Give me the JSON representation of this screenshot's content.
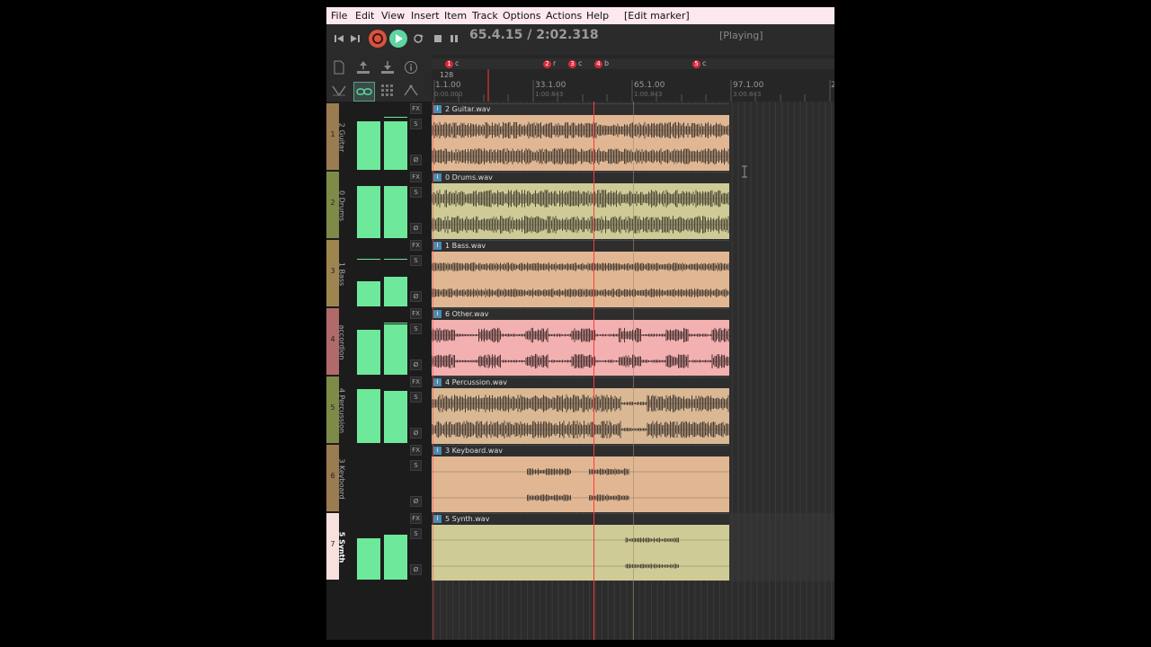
{
  "menu": {
    "file": "File",
    "edit": "Edit",
    "view": "View",
    "insert": "Insert",
    "item": "Item",
    "track": "Track",
    "options": "Options",
    "actions": "Actions",
    "help": "Help",
    "context": "[Edit marker]"
  },
  "transport": {
    "time": "65.4.15 / 2:02.318",
    "status": "[Playing]"
  },
  "ruler": {
    "tempo": "128",
    "markers": [
      {
        "num": "1",
        "label": "c"
      },
      {
        "num": "2",
        "label": "r"
      },
      {
        "num": "3",
        "label": "c"
      },
      {
        "num": "4",
        "label": "b"
      },
      {
        "num": "5",
        "label": "c"
      }
    ],
    "ticks": [
      {
        "bar": "1.1.00",
        "time": "0:00.000"
      },
      {
        "bar": "33.1.00",
        "time": "1:00.843"
      },
      {
        "bar": "65.1.00",
        "time": "1:00.843"
      },
      {
        "bar": "97.1.00",
        "time": "3:00.843"
      },
      {
        "bar": "2",
        "time": ""
      }
    ]
  },
  "tracks": [
    {
      "number": "1",
      "name": "2 Guitar",
      "item": "2 Guitar.wav",
      "color": "#9b7b50",
      "item_color": "#e1b793",
      "wave_color": "#4a4037",
      "meter": [
        0.93,
        0.93
      ],
      "peak": [
        0.95,
        0.95
      ]
    },
    {
      "number": "2",
      "name": "0 Drums",
      "item": "0 Drums.wav",
      "color": "#7e8b48",
      "item_color": "#cfcb96",
      "wave_color": "#4c4a3a",
      "meter": [
        0.98,
        0.98
      ],
      "peak": [
        1.0,
        1.0
      ]
    },
    {
      "number": "3",
      "name": "1 Bass",
      "item": "1 Bass.wav",
      "color": "#9e8550",
      "item_color": "#e1b793",
      "wave_color": "#4a4037",
      "meter": [
        0.5,
        0.58
      ],
      "peak": [
        0.87,
        0.87
      ]
    },
    {
      "number": "4",
      "name": "accordion",
      "item": "6 Other.wav",
      "color": "#b06a6a",
      "item_color": "#f2b0b0",
      "wave_color": "#4b3232",
      "meter": [
        0.85,
        0.95
      ],
      "peak": [
        0.97,
        0.97
      ]
    },
    {
      "number": "5",
      "name": "4 Percussion",
      "item": "4 Percussion.wav",
      "color": "#7e8b48",
      "item_color": "#d9b893",
      "wave_color": "#4a4037",
      "meter": [
        0.98,
        0.98
      ],
      "peak": [
        1.0,
        1.0
      ]
    },
    {
      "number": "6",
      "name": "3 Keyboard",
      "item": "3 Keyboard.wav",
      "color": "#9b7b50",
      "item_color": "#e1b793",
      "wave_color": "#4a4037",
      "meter": [
        0,
        0
      ],
      "peak": [
        0,
        0
      ]
    },
    {
      "number": "7",
      "name": "5 Synth",
      "item": "5 Synth.wav",
      "color": "#f7e0dd",
      "item_color": "#cfcb96",
      "wave_color": "#4c4a3a",
      "meter": [
        0.78,
        0.82
      ],
      "peak": [
        0,
        0
      ],
      "selected": true
    }
  ],
  "track_buttons": {
    "fx": "FX",
    "solo": "S",
    "phase": "Ø"
  },
  "colors": {
    "meter": "#6ee89a",
    "playhead": "#ff3a3a",
    "menubar": "#fde8f0",
    "marker": "#d62a3a"
  },
  "icons": [
    "prev-icon",
    "next-icon",
    "record-icon",
    "play-icon",
    "repeat-icon",
    "stop-icon",
    "pause-icon",
    "new-file-icon",
    "upload-icon",
    "download-icon",
    "info-icon",
    "shuffle-icon",
    "link-icon",
    "grid-icon",
    "envelope-icon"
  ]
}
